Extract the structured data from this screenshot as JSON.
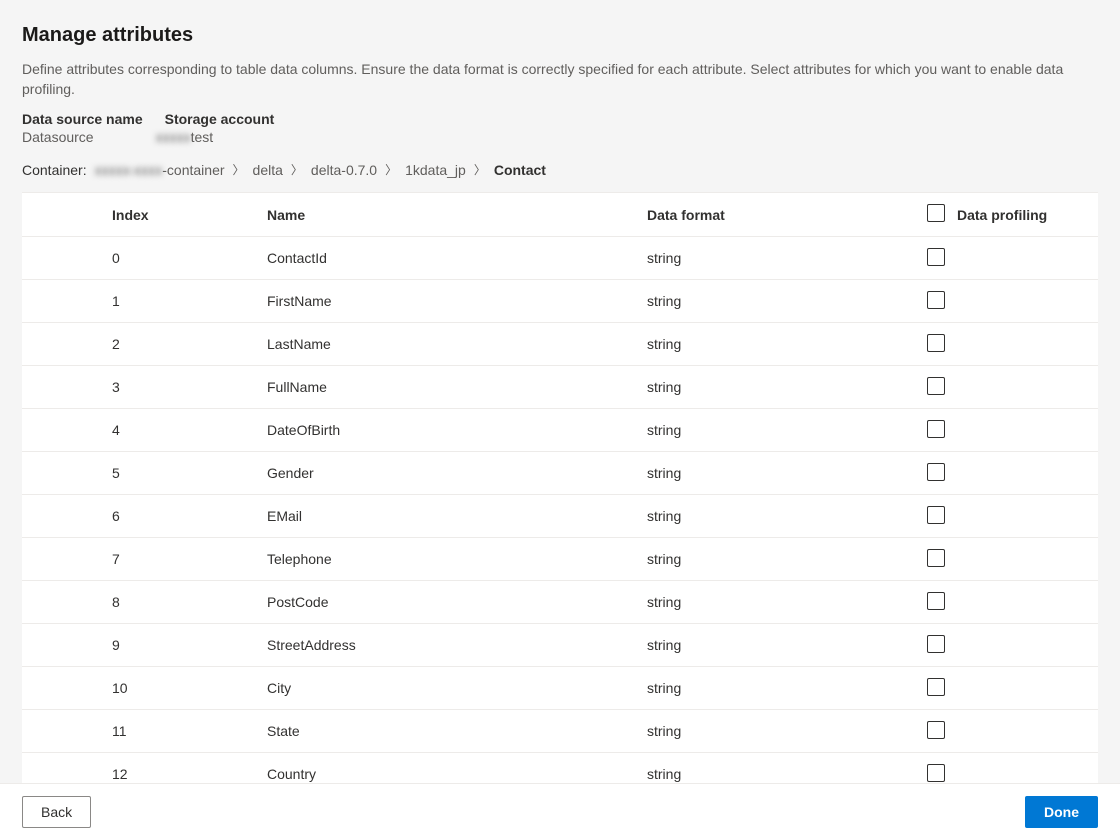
{
  "header": {
    "title": "Manage attributes",
    "subtitle": "Define attributes corresponding to table data columns. Ensure the data format is correctly specified for each attribute. Select attributes for which you want to enable data profiling."
  },
  "meta": {
    "datasource_label": "Data source name",
    "storage_label": "Storage account",
    "datasource_value": "Datasource",
    "storage_prefix_masked": "xxxxx",
    "storage_suffix": "test"
  },
  "breadcrumb": {
    "container_label": "Container:",
    "container_masked": "xxxxx-xxxx",
    "container_suffix": "-container",
    "items": [
      {
        "label": "delta"
      },
      {
        "label": "delta-0.7.0"
      },
      {
        "label": "1kdata_jp"
      },
      {
        "label": "Contact",
        "current": true
      }
    ]
  },
  "table": {
    "columns": {
      "index": "Index",
      "name": "Name",
      "format": "Data format",
      "profiling": "Data profiling"
    },
    "rows": [
      {
        "index": "0",
        "name": "ContactId",
        "format": "string"
      },
      {
        "index": "1",
        "name": "FirstName",
        "format": "string"
      },
      {
        "index": "2",
        "name": "LastName",
        "format": "string"
      },
      {
        "index": "3",
        "name": "FullName",
        "format": "string"
      },
      {
        "index": "4",
        "name": "DateOfBirth",
        "format": "string"
      },
      {
        "index": "5",
        "name": "Gender",
        "format": "string"
      },
      {
        "index": "6",
        "name": "EMail",
        "format": "string"
      },
      {
        "index": "7",
        "name": "Telephone",
        "format": "string"
      },
      {
        "index": "8",
        "name": "PostCode",
        "format": "string"
      },
      {
        "index": "9",
        "name": "StreetAddress",
        "format": "string"
      },
      {
        "index": "10",
        "name": "City",
        "format": "string"
      },
      {
        "index": "11",
        "name": "State",
        "format": "string"
      },
      {
        "index": "12",
        "name": "Country",
        "format": "string"
      }
    ]
  },
  "footer": {
    "back": "Back",
    "done": "Done"
  }
}
